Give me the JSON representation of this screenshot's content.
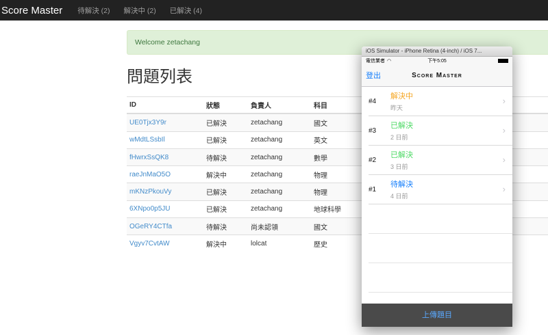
{
  "navbar": {
    "brand": "Score Master",
    "items": [
      {
        "label": "待解決 (2)"
      },
      {
        "label": "解決中 (2)"
      },
      {
        "label": "已解決 (4)"
      }
    ]
  },
  "alert": {
    "text": "Welcome zetachang"
  },
  "page_title": "問題列表",
  "table": {
    "headers": [
      "ID",
      "狀態",
      "負責人",
      "科目"
    ],
    "rows": [
      {
        "id": "UE0Tjx3Y9r",
        "status": "已解決",
        "owner": "zetachang",
        "subject": "國文"
      },
      {
        "id": "wMdtLSsbIl",
        "status": "已解決",
        "owner": "zetachang",
        "subject": "英文"
      },
      {
        "id": "fHwrxSsQK8",
        "status": "待解決",
        "owner": "zetachang",
        "subject": "數學"
      },
      {
        "id": "raeJnMaO5O",
        "status": "解決中",
        "owner": "zetachang",
        "subject": "物理"
      },
      {
        "id": "mKNzPkouVy",
        "status": "已解決",
        "owner": "zetachang",
        "subject": "物理"
      },
      {
        "id": "6XNpo0p5JU",
        "status": "已解決",
        "owner": "zetachang",
        "subject": "地球科學"
      },
      {
        "id": "OGeRY4CTfa",
        "status": "待解決",
        "owner": "尚未認領",
        "subject": "國文"
      },
      {
        "id": "Vgyv7CvtAW",
        "status": "解決中",
        "owner": "lolcat",
        "subject": "歷史"
      }
    ]
  },
  "simulator": {
    "window_title": "iOS Simulator - iPhone Retina (4-inch) / iOS 7...",
    "status_bar": {
      "carrier": "電信業者",
      "time": "下午5:05"
    },
    "nav": {
      "left": "登出",
      "title": "Score Master"
    },
    "cells": [
      {
        "num": "#4",
        "status": "解決中",
        "age": "昨天",
        "color": "#f5a623"
      },
      {
        "num": "#3",
        "status": "已解決",
        "age": "2 日前",
        "color": "#4cd964"
      },
      {
        "num": "#2",
        "status": "已解決",
        "age": "3 日前",
        "color": "#4cd964"
      },
      {
        "num": "#1",
        "status": "待解決",
        "age": "4 日前",
        "color": "#147efb"
      }
    ],
    "upload_button": "上傳題目"
  }
}
